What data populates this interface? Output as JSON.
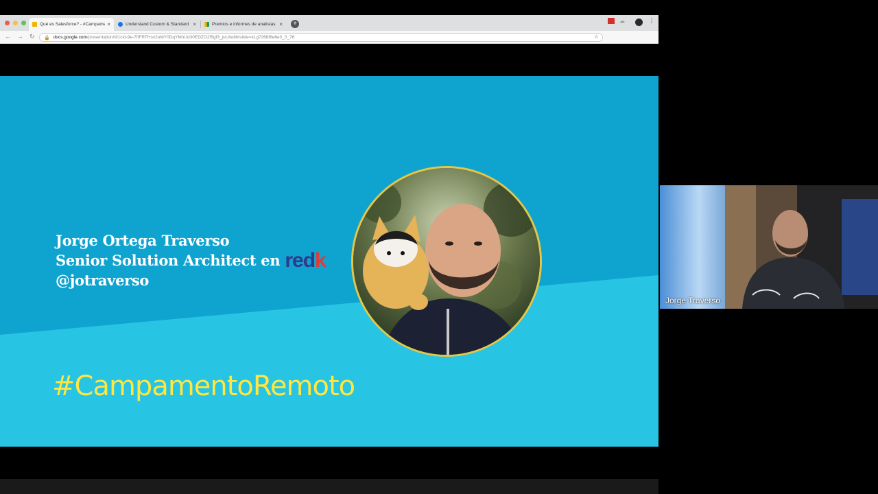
{
  "browser": {
    "tabs": [
      {
        "title": "Qué es Salesforce? - #Campamen",
        "favicon_color": "#f4b400",
        "active": true
      },
      {
        "title": "Understand Custom & Standard",
        "favicon_color": "#1a73e8",
        "active": false
      },
      {
        "title": "Premios e informes de analistas",
        "favicon_color": "#0f9d58",
        "active": false
      }
    ],
    "close_glyph": "×",
    "new_tab_glyph": "+",
    "url_domain": "docs.google.com",
    "url_path": "/presentation/d/1cid-9e-7fIFRTHsv2uMY0DqYMnUd30EDZO2f5gf3_juU/edit#slide=id.g7268f8e6e3_0_76",
    "icons": {
      "back": "back-arrow-icon",
      "forward": "forward-arrow-icon",
      "reload": "reload-icon",
      "lock": "lock-icon",
      "star": "star-icon",
      "menu": "kebab-menu-icon"
    }
  },
  "slide": {
    "speaker_lines": [
      "Jorge Ortega Traverso",
      "Senior Solution Architect en",
      "@jotraverso"
    ],
    "brand_logo": {
      "part1": "red",
      "part2": "k"
    },
    "hashtag": "#CampamentoRemoto",
    "colors": {
      "upper": "#0fa3cf",
      "lower": "#27c4e4",
      "hashtag": "#ffe640",
      "ring": "#e3c748"
    }
  },
  "webcam": {
    "name": "Jorge Traverso"
  }
}
